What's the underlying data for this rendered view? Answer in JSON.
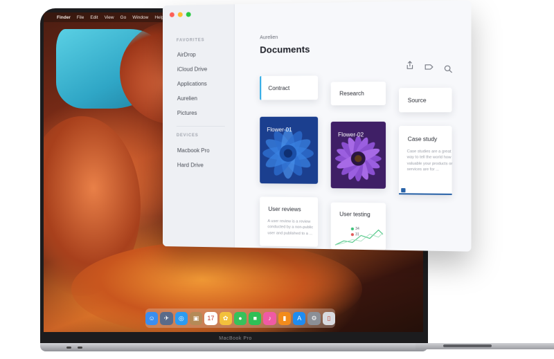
{
  "menu_bar": {
    "app_name": "Finder",
    "items": [
      "File",
      "Edit",
      "View",
      "Go",
      "Window",
      "Help"
    ]
  },
  "dock": {
    "icons": [
      {
        "name": "finder-icon",
        "color": "#3b8ef0",
        "glyph": "☺"
      },
      {
        "name": "launchpad-icon",
        "color": "#5a6b8a",
        "glyph": "✈"
      },
      {
        "name": "safari-icon",
        "color": "#2d9bf0",
        "glyph": "◎"
      },
      {
        "name": "contacts-icon",
        "color": "#b58a57",
        "glyph": "▣"
      },
      {
        "name": "calendar-icon",
        "color": "#ffffff",
        "glyph": "17"
      },
      {
        "name": "photos-icon",
        "color": "#f3c03c",
        "glyph": "✿"
      },
      {
        "name": "messages-icon",
        "color": "#37c15b",
        "glyph": "●"
      },
      {
        "name": "facetime-icon",
        "color": "#2fbf56",
        "glyph": "■"
      },
      {
        "name": "itunes-icon",
        "color": "#f05aa4",
        "glyph": "♪"
      },
      {
        "name": "ibooks-icon",
        "color": "#f28b1c",
        "glyph": "▮"
      },
      {
        "name": "app-store-icon",
        "color": "#1f8cf0",
        "glyph": "A"
      },
      {
        "name": "system-preferences-icon",
        "color": "#8b8f96",
        "glyph": "⚙"
      },
      {
        "name": "trash-icon",
        "color": "#d8dbe0",
        "glyph": "▯"
      }
    ]
  },
  "laptop": {
    "brand": "MacBook Pro"
  },
  "finder": {
    "sidebar": {
      "favorites_title": "FAVORITES",
      "favorites": [
        "AirDrop",
        "iCloud Drive",
        "Applications",
        "Aurelien",
        "Pictures"
      ],
      "devices_title": "DEVICES",
      "devices": [
        "Macbook Pro",
        "Hard Drive"
      ]
    },
    "breadcrumb": "Aurelien",
    "title": "Documents",
    "toolbar": {
      "share_icon": "share-icon",
      "tag_icon": "tag-icon",
      "search_icon": "search-icon"
    },
    "cards": {
      "contract": "Contract",
      "research": "Research",
      "source": "Source",
      "flower1": "Flower-01",
      "flower2": "Flower-02",
      "case_study": {
        "title": "Case study",
        "desc": "Case studies are a great way to tell the world how valuable your products or services are for ..."
      },
      "user_reviews": {
        "title": "User reviews",
        "desc": "A user review is a review conducted by a non-public user and published to a ..."
      },
      "user_testing": {
        "title": "User testing",
        "stat1": "34",
        "stat2": "31"
      }
    },
    "accent_color": "#2aa9e6"
  }
}
